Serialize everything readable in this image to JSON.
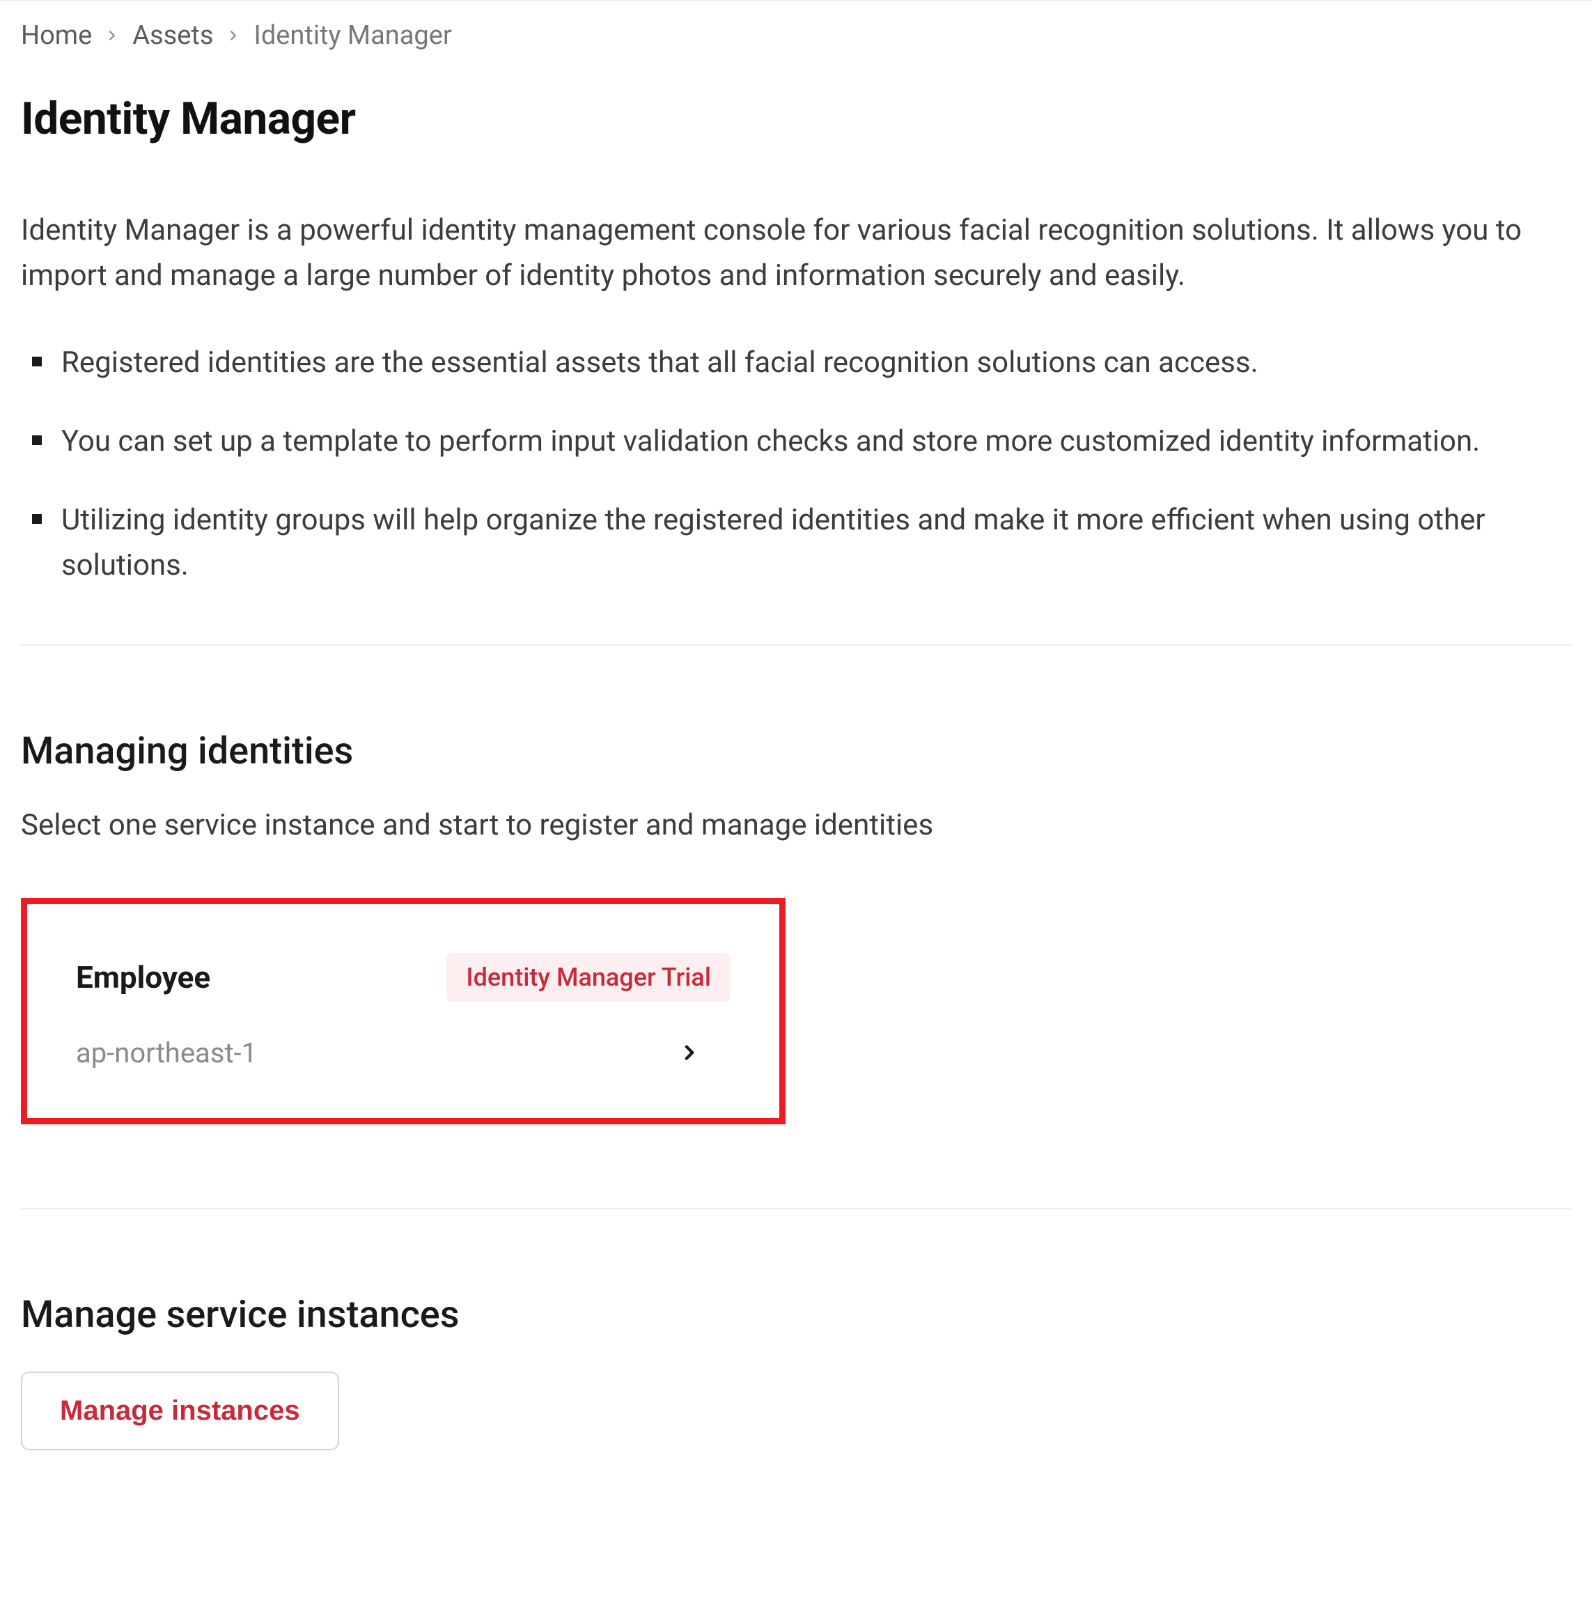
{
  "breadcrumb": {
    "home": "Home",
    "assets": "Assets",
    "current": "Identity Manager"
  },
  "page_title": "Identity Manager",
  "intro": "Identity Manager is a powerful identity management console for various facial recognition solutions. It allows you to import and manage a large number of identity photos and information securely and easily.",
  "bullets": {
    "b1": "Registered identities are the essential assets that all facial recognition solutions can access.",
    "b2": "You can set up a template to perform input validation checks and store more customized identity information.",
    "b3": "Utilizing identity groups will help organize the registered identities and make it more efficient when using other solutions."
  },
  "managing": {
    "title": "Managing identities",
    "desc": "Select one service instance and start to register and manage identities",
    "instance": {
      "name": "Employee",
      "badge": "Identity Manager Trial",
      "region": "ap-northeast-1"
    }
  },
  "service_instances": {
    "title": "Manage service instances",
    "button": "Manage instances"
  }
}
